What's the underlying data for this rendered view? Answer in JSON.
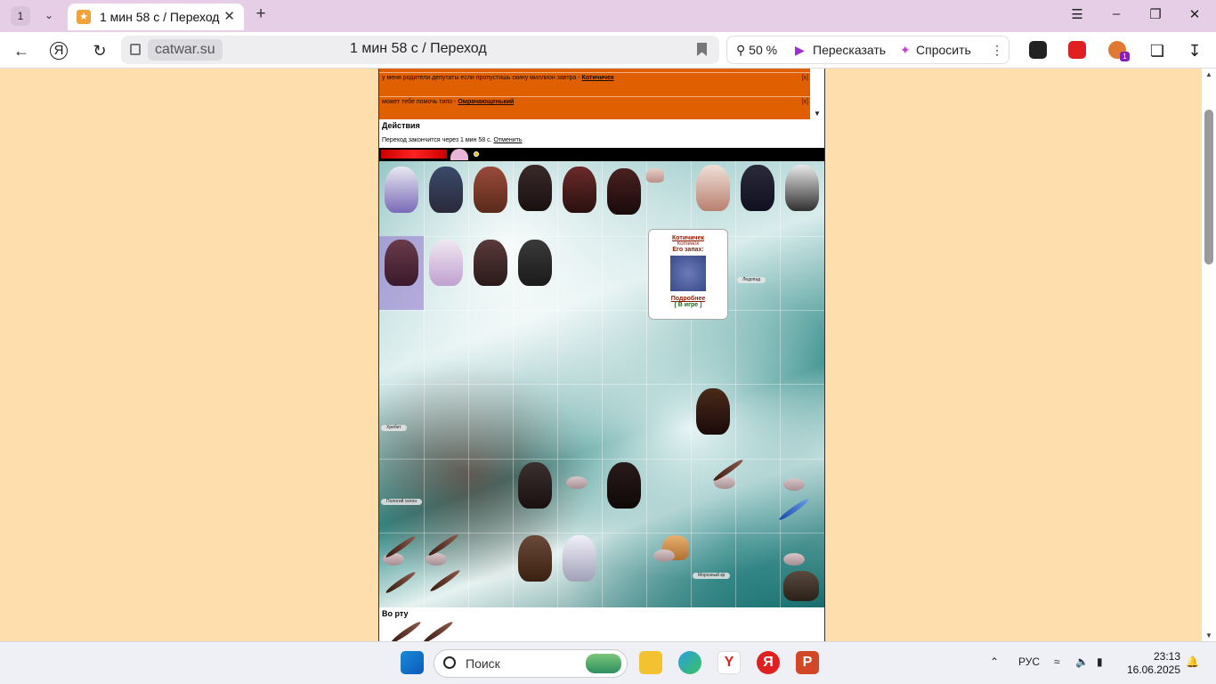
{
  "browser": {
    "tab_count": "1",
    "tab_title": "1 мин 58 с / Переход",
    "url_domain": "catwar.su",
    "page_title": "1 мин 58 с / Переход",
    "zoom": "50 %",
    "retell_label": "Пересказать",
    "ask_label": "Спросить",
    "alice_badge": "1"
  },
  "chat": {
    "messages": [
      {
        "text": "у меня родители депутаты если пропустишь скину миллион завтра - ",
        "author": "Котичичек",
        "badge": "[x]"
      },
      {
        "text": "может тебе помочь типо - ",
        "author": "Омрачающенький",
        "badge": "[x]"
      }
    ]
  },
  "actions": {
    "heading": "Действия",
    "transition_text": "Переход закончится через 1 мин 58 с.",
    "cancel_label": "Отменить"
  },
  "popup": {
    "name": "Котичичек",
    "role": "Котёнок",
    "smell_label": "Его запах:",
    "more_label": "Подробнее",
    "status": "[ В игре ]"
  },
  "locations": {
    "ledopad": "Ледопад",
    "hrebet": "Хребет",
    "pologiy": "Пологий склон",
    "morozny": "Морозный кр"
  },
  "mouth": {
    "heading": "Во рту"
  },
  "taskbar": {
    "search_label": "Поиск",
    "lang": "РУС",
    "time": "23:13",
    "date": "16.06.2025"
  },
  "colors": {
    "page_bg": "#ffdead",
    "chat_bg": "#e05f00",
    "accent_link": "#8b1a00"
  }
}
